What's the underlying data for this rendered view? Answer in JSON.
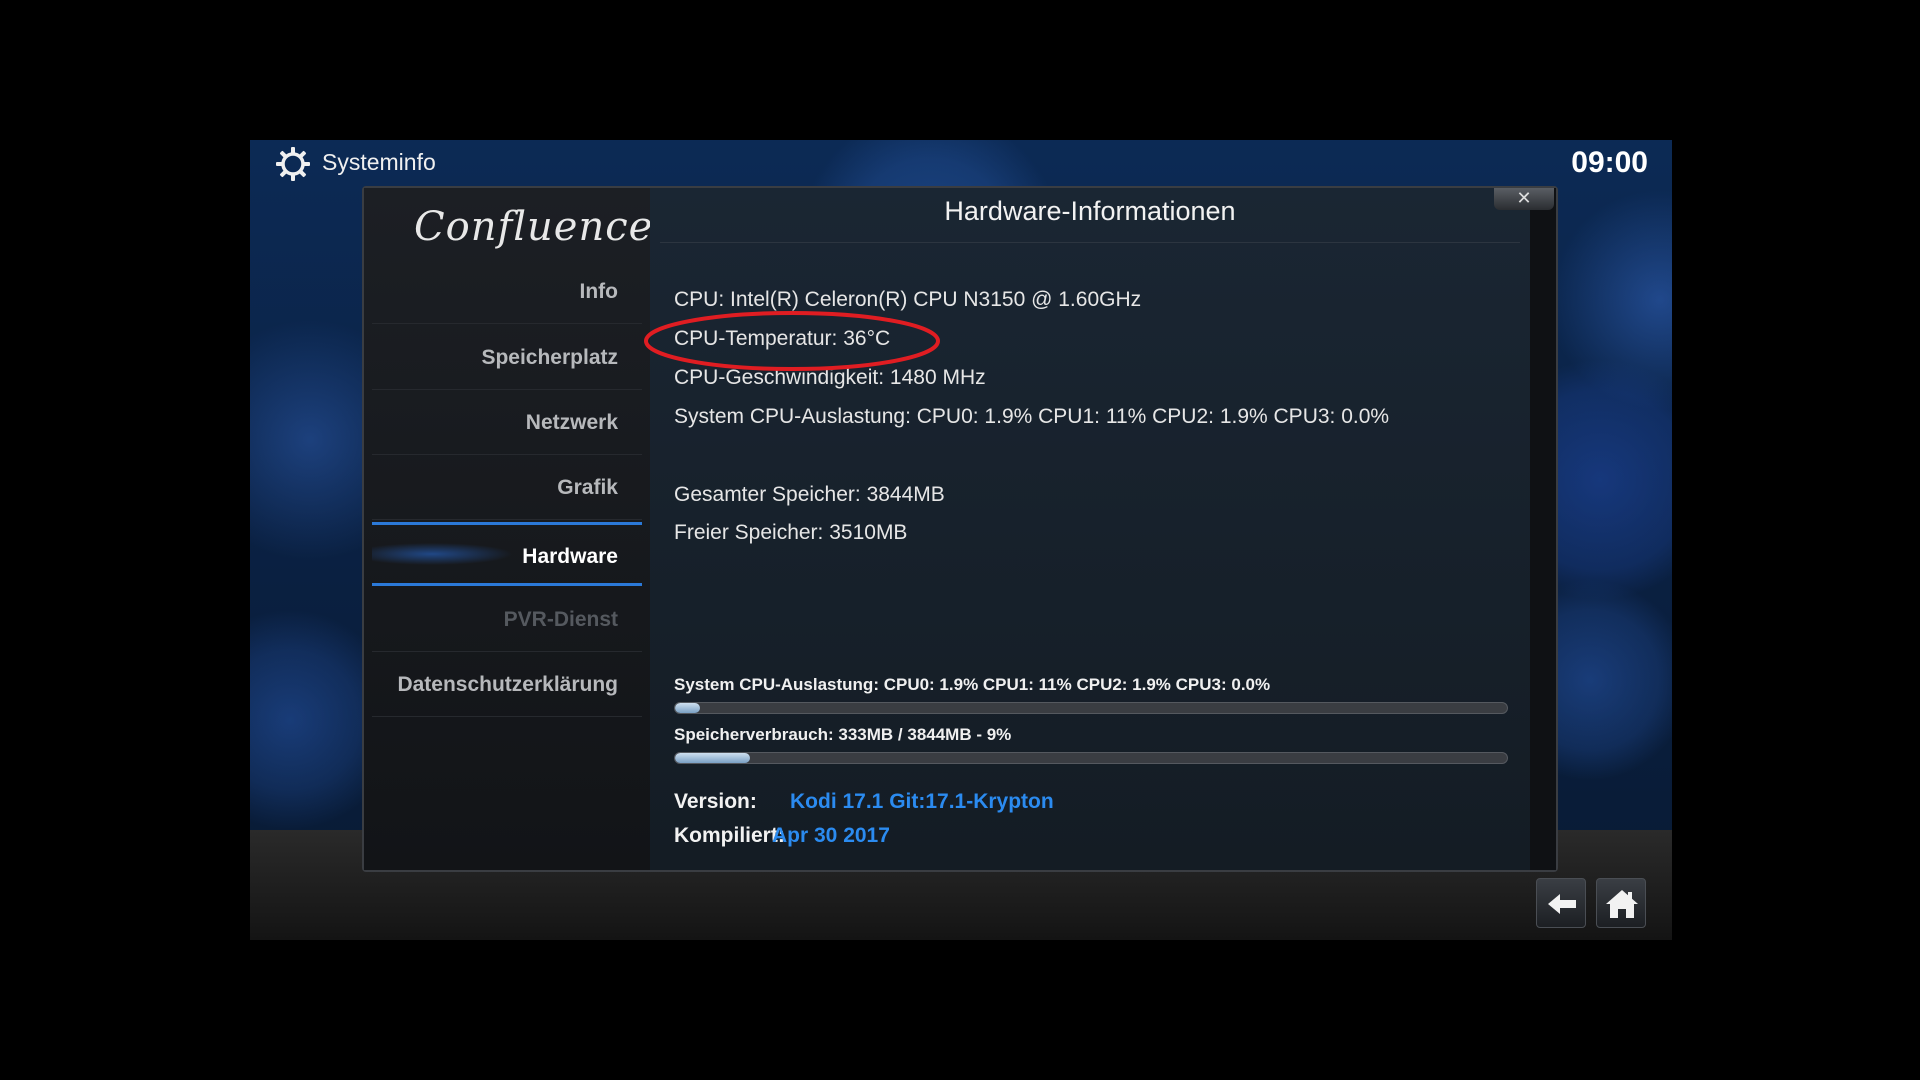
{
  "topbar": {
    "icon": "gear-icon",
    "title": "Systeminfo",
    "clock": "09:00"
  },
  "sidebar": {
    "logo": "Confluence",
    "items": [
      {
        "label": "Info",
        "state": "normal"
      },
      {
        "label": "Speicherplatz",
        "state": "normal"
      },
      {
        "label": "Netzwerk",
        "state": "normal"
      },
      {
        "label": "Grafik",
        "state": "normal"
      },
      {
        "label": "Hardware",
        "state": "active"
      },
      {
        "label": "PVR-Dienst",
        "state": "disabled"
      },
      {
        "label": "Datenschutzerklärung",
        "state": "normal"
      }
    ]
  },
  "content": {
    "title": "Hardware-Informationen",
    "close_label": "✕",
    "lines": [
      "CPU: Intel(R) Celeron(R) CPU N3150 @ 1.60GHz",
      "CPU-Temperatur: 36°C",
      "CPU-Geschwindigkeit: 1480 MHz",
      "System CPU-Auslastung: CPU0: 1.9% CPU1:  11% CPU2: 1.9% CPU3: 0.0%",
      "Gesamter Speicher: 3844MB",
      "Freier Speicher: 3510MB"
    ],
    "highlighted_line": "CPU-Temperatur: 36°C",
    "highlight_color": "#e01d22",
    "bars": [
      {
        "label": "System CPU-Auslastung: CPU0: 1.9% CPU1:  11% CPU2: 1.9% CPU3: 0.0%",
        "percent": 3
      },
      {
        "label": "Speicherverbrauch: 333MB / 3844MB - 9%",
        "percent": 9
      }
    ],
    "version_label": "Version:",
    "version_value": "Kodi 17.1 Git:17.1-Krypton",
    "compiled_label": "Kompiliert:",
    "compiled_value": "Apr 30 2017",
    "accent_color": "#2b8bf0"
  },
  "footer": {
    "back_icon": "back-arrow-icon",
    "home_icon": "home-icon"
  }
}
